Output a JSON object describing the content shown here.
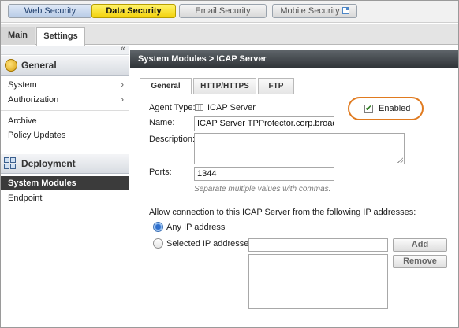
{
  "product_tabs": {
    "web": "Web Security",
    "data": "Data Security",
    "email": "Email Security",
    "mobile": "Mobile Security"
  },
  "sub_tabs": {
    "main": "Main",
    "settings": "Settings"
  },
  "sidebar": {
    "collapse_glyph": "«",
    "general_header": "General",
    "general_items": [
      {
        "label": "System",
        "chevron": "›"
      },
      {
        "label": "Authorization",
        "chevron": "›"
      },
      {
        "label": "Archive"
      },
      {
        "label": "Policy Updates"
      }
    ],
    "deployment_header": "Deployment",
    "deployment_items": [
      {
        "label": "System Modules",
        "active": true
      },
      {
        "label": "Endpoint"
      }
    ]
  },
  "breadcrumb": {
    "parent": "System Modules",
    "separator": ">",
    "current": "ICAP Server"
  },
  "content_tabs": {
    "general": "General",
    "http": "HTTP/HTTPS",
    "ftp": "FTP"
  },
  "form": {
    "agent_type_label": "Agent Type:",
    "agent_type_value": "ICAP Server",
    "enabled_label": "Enabled",
    "enabled_checked": true,
    "name_label": "Name:",
    "name_value": "ICAP Server TPProtector.corp.broadway",
    "description_label": "Description:",
    "description_value": "",
    "ports_label": "Ports:",
    "ports_value": "1344",
    "ports_hint": "Separate multiple values with commas.",
    "allow_label": "Allow connection to this ICAP Server from the following IP addresses:",
    "any_ip_label": "Any IP address",
    "selected_ip_label": "Selected IP addresses:",
    "ip_input_value": "",
    "add_button": "Add",
    "remove_button": "Remove"
  },
  "colors": {
    "data_tab": "#f3d20c",
    "highlight_ring": "#e07a1f",
    "active_nav": "#3b3b3b",
    "titlebar": "#2e3236"
  }
}
